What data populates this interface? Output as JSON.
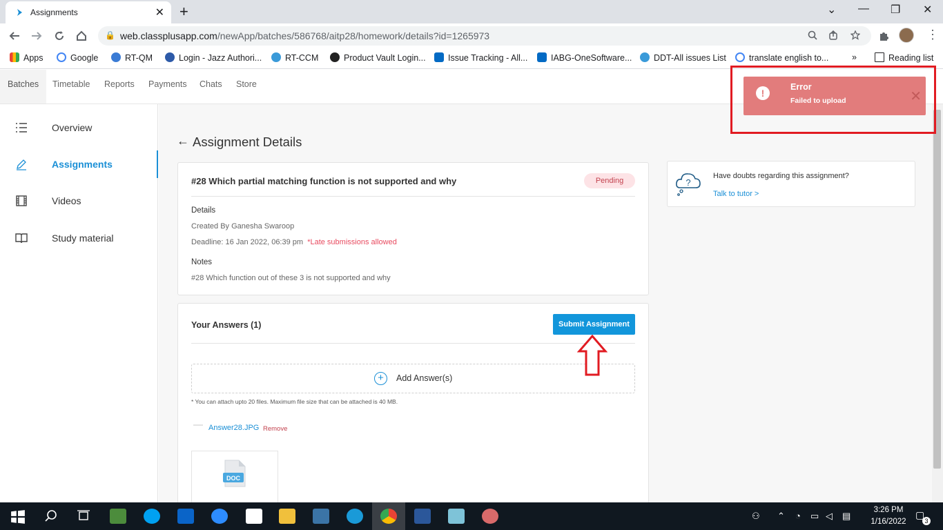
{
  "browser": {
    "tab_title": "Assignments",
    "tab_close": "✕",
    "new_tab": "+",
    "url_host": "web.classplusapp.com",
    "url_path": "/newApp/batches/586768/aitp28/homework/details?id=1265973",
    "win_min": "⌄",
    "win_minimize": "—",
    "win_restore": "❐",
    "win_close": "✕"
  },
  "bookmarks": [
    {
      "label": "Apps",
      "color": "#e94335"
    },
    {
      "label": "Google",
      "color": "#4285f4"
    },
    {
      "label": "RT-QM",
      "color": "#3a7bd5"
    },
    {
      "label": "Login - Jazz Authori...",
      "color": "#2d5aa8"
    },
    {
      "label": "RT-CCM",
      "color": "#3a9ad9"
    },
    {
      "label": "Product Vault Login...",
      "color": "#222"
    },
    {
      "label": "Issue Tracking - All...",
      "color": "#036ac4"
    },
    {
      "label": "IABG-OneSoftware...",
      "color": "#036ac4"
    },
    {
      "label": "DDT-All issues List",
      "color": "#3a9ad9"
    },
    {
      "label": "translate english to...",
      "color": "#4285f4"
    }
  ],
  "bookmarks_more": "»",
  "reading_list": "Reading list",
  "app_menu": [
    "Batches",
    "Timetable",
    "Reports",
    "Payments",
    "Chats",
    "Store"
  ],
  "sidebar": [
    {
      "label": "Overview",
      "icon": "list-icon"
    },
    {
      "label": "Assignments",
      "icon": "pencil-icon"
    },
    {
      "label": "Videos",
      "icon": "film-icon"
    },
    {
      "label": "Study material",
      "icon": "book-icon"
    }
  ],
  "page": {
    "back_arrow": "←",
    "title": "Assignment Details"
  },
  "assignment": {
    "title": "#28 Which partial matching function is not supported and why",
    "status": "Pending",
    "details_label": "Details",
    "created_by": "Created By Ganesha Swaroop",
    "deadline": "Deadline: 16 Jan 2022,  06:39 pm",
    "late": "*Late submissions allowed",
    "notes_label": "Notes",
    "notes": "#28 Which function out of these 3 is not supported and why"
  },
  "answers": {
    "title": "Your Answers (1)",
    "submit_label": "Submit Assignment",
    "add_label": "Add Answer(s)",
    "add_plus": "+",
    "note": "* You can attach upto 20 files. Maximum file size that can be attached is 40 MB.",
    "file_name": "Answer28.JPG",
    "remove_label": "Remove",
    "thumb_type": "DOC"
  },
  "doubts": {
    "question": "Have doubts regarding this assignment?",
    "link": "Talk to tutor >",
    "icon_glyph": "?"
  },
  "toast": {
    "title": "Error",
    "message": "Failed to upload",
    "bang": "!",
    "close": "✕",
    "color": "#e27c7c"
  },
  "taskbar": {
    "time": "3:26 PM",
    "date": "1/16/2022",
    "notifications": "3"
  },
  "colors": {
    "accent": "#1296db",
    "annotation_red": "#e11b22"
  }
}
